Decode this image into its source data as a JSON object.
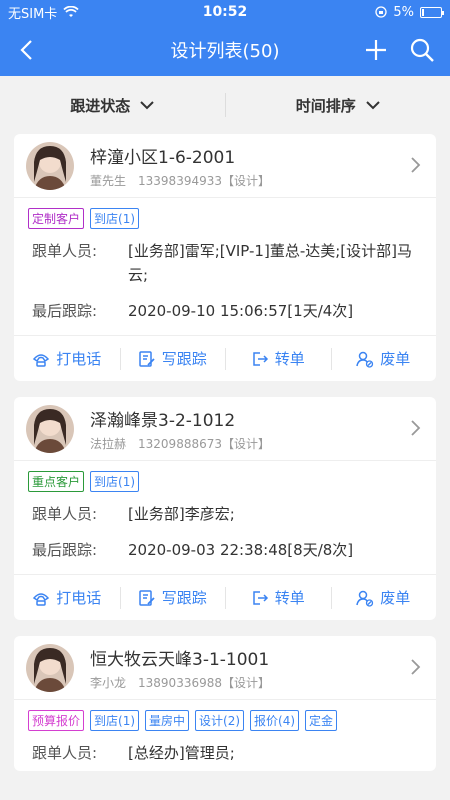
{
  "status": {
    "carrier": "无SIM卡",
    "time": "10:52",
    "battery": "5%"
  },
  "nav": {
    "title": "设计列表(50)"
  },
  "filters": [
    {
      "label": "跟进状态"
    },
    {
      "label": "时间排序"
    }
  ],
  "labels": {
    "staff": "跟单人员:",
    "last_follow": "最后跟踪:"
  },
  "actions": {
    "call": "打电话",
    "write": "写跟踪",
    "transfer": "转单",
    "abandon": "废单"
  },
  "cards": [
    {
      "title": "梓潼小区1-6-2001",
      "name": "董先生",
      "phone": "13398394933【设计】",
      "tags": [
        "定制客户",
        "到店(1)"
      ],
      "staff": "[业务部]雷军;[VIP-1]董总-达美;[设计部]马云;",
      "last_follow": "2020-09-10 15:06:57[1天/4次]"
    },
    {
      "title": "泽瀚峰景3-2-1012",
      "name": "法拉赫",
      "phone": "13209888673【设计】",
      "tags": [
        "重点客户",
        "到店(1)"
      ],
      "staff": "[业务部]李彦宏;",
      "last_follow": "2020-09-03 22:38:48[8天/8次]"
    },
    {
      "title": "恒大牧云天峰3-1-1001",
      "name": "李小龙",
      "phone": "13890336988【设计】",
      "tags": [
        "预算报价",
        "到店(1)",
        "量房中",
        "设计(2)",
        "报价(4)",
        "定金"
      ],
      "staff": "[总经办]管理员;"
    }
  ]
}
